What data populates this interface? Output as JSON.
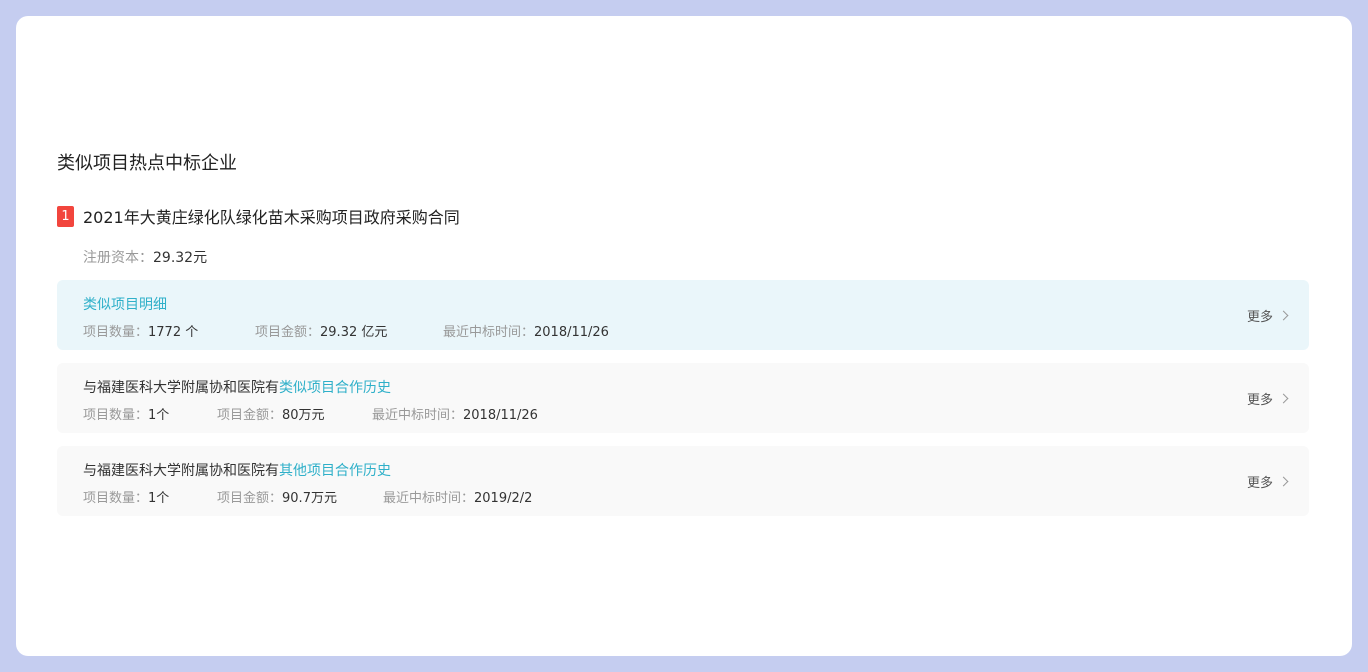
{
  "section": {
    "title": "类似项目热点中标企业"
  },
  "company": {
    "rank": "1",
    "name": "2021年大黄庄绿化队绿化苗木采购项目政府采购合同",
    "capital_label": "注册资本：",
    "capital_value": "29.32元"
  },
  "boxes": [
    {
      "title_prefix": "",
      "title_link": "类似项目明细",
      "count_label": "项目数量：",
      "count_value": "1772 个",
      "amount_label": "项目金额：",
      "amount_value": "29.32 亿元",
      "time_label": "最近中标时间：",
      "time_value": "2018/11/26",
      "more": "更多"
    },
    {
      "title_prefix": "与福建医科大学附属协和医院有",
      "title_link": "类似项目合作历史",
      "count_label": "项目数量：",
      "count_value": "1个",
      "amount_label": "项目金额：",
      "amount_value": "80万元",
      "time_label": "最近中标时间：",
      "time_value": "2018/11/26",
      "more": "更多"
    },
    {
      "title_prefix": "与福建医科大学附属协和医院有",
      "title_link": "其他项目合作历史",
      "count_label": "项目数量：",
      "count_value": "1个",
      "amount_label": "项目金额：",
      "amount_value": "90.7万元",
      "time_label": "最近中标时间：",
      "time_value": "2019/2/2",
      "more": "更多"
    }
  ],
  "colors": {
    "frame": "#c5cdf0",
    "accent_link": "#2fb0c9",
    "badge": "#f2453d",
    "highlight_bg": "#eaf6fa"
  }
}
